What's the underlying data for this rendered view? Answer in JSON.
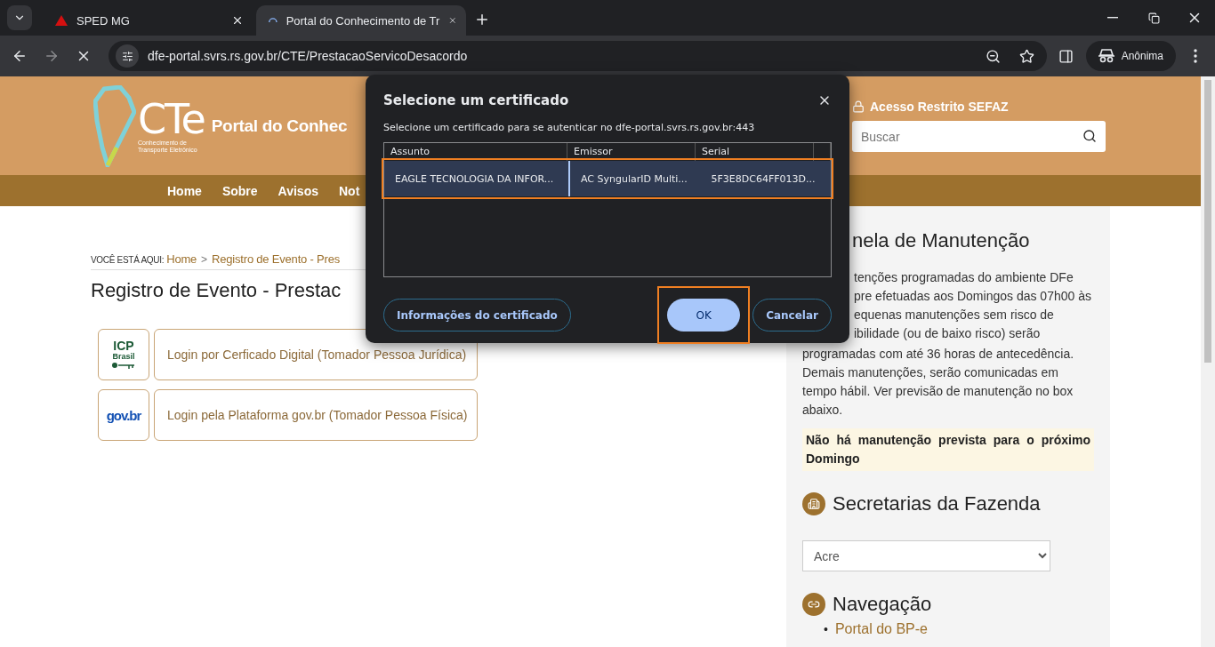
{
  "browser": {
    "tabs": [
      {
        "title": "SPED MG",
        "selected": false,
        "kind": "site"
      },
      {
        "title": "Portal do Conhecimento de Tr",
        "selected": true,
        "kind": "loading"
      }
    ],
    "url": "dfe-portal.svrs.rs.gov.br/CTE/PrestacaoServicoDesacordo",
    "profile": "Anônima"
  },
  "header": {
    "logo": {
      "mark": "CTe",
      "caption": [
        "Conhecimento de",
        "Transporte Eletrônico"
      ]
    },
    "portal_title": "Portal do Conhec",
    "access_label": "Acesso Restrito SEFAZ",
    "search_placeholder": "Buscar"
  },
  "nav": [
    "Home",
    "Sobre",
    "Avisos",
    "Not"
  ],
  "breadcrumb": {
    "label": "VOCÊ ESTÁ AQUI:",
    "items": [
      "Home",
      "Registro de Evento - Pres"
    ],
    "separator": ">"
  },
  "title": "Registro de Evento - Prestac",
  "login_options": [
    {
      "kind": "icp",
      "logo_text": [
        "ICP",
        "Brasil"
      ],
      "label": "Login por Cerficado Digital (Tomador Pessoa Jurídica)"
    },
    {
      "kind": "govbr",
      "logo_text": [
        "gov.br"
      ],
      "label": "Login pela Plataforma gov.br (Tomador Pessoa Física)"
    }
  ],
  "sidebar": {
    "maintenance": {
      "title": "nela de Manutenção",
      "covered_lines": [
        "tenções programadas do ambiente DFe",
        "pre efetuadas aos Domingos das 07h00 às",
        "equenas manutenções sem risco de",
        "ibilidade (ou de baixo risco) serão"
      ],
      "paragraph": "programadas com até 36 horas de antecedência. Demais manutenções, serão comunicadas em tempo hábil. Ver previsão de manutenção no box abaixo.",
      "notice": "Não há manutenção prevista para o próximo Domingo"
    },
    "secretarias": {
      "title": "Secretarias da Fazenda",
      "select_value": "Acre"
    },
    "navegacao": {
      "title": "Navegação",
      "marker": "•",
      "links": [
        "Portal do BP-e"
      ]
    }
  },
  "dialog": {
    "title": "Selecione um certificado",
    "subtitle": "Selecione um certificado para se autenticar no dfe-portal.svrs.rs.gov.br:443",
    "columns": [
      "Assunto",
      "Emissor",
      "Serial"
    ],
    "rows": [
      {
        "cells": [
          "EAGLE TECNOLOGIA DA INFOR...",
          "AC SyngularID Multi...",
          "5F3E8DC64FF013D..."
        ],
        "selected": true,
        "annotated": true
      }
    ],
    "info_button": "Informações do certificado",
    "ok_button": {
      "label": "OK",
      "annotated": true
    },
    "cancel_button": "Cancelar"
  }
}
